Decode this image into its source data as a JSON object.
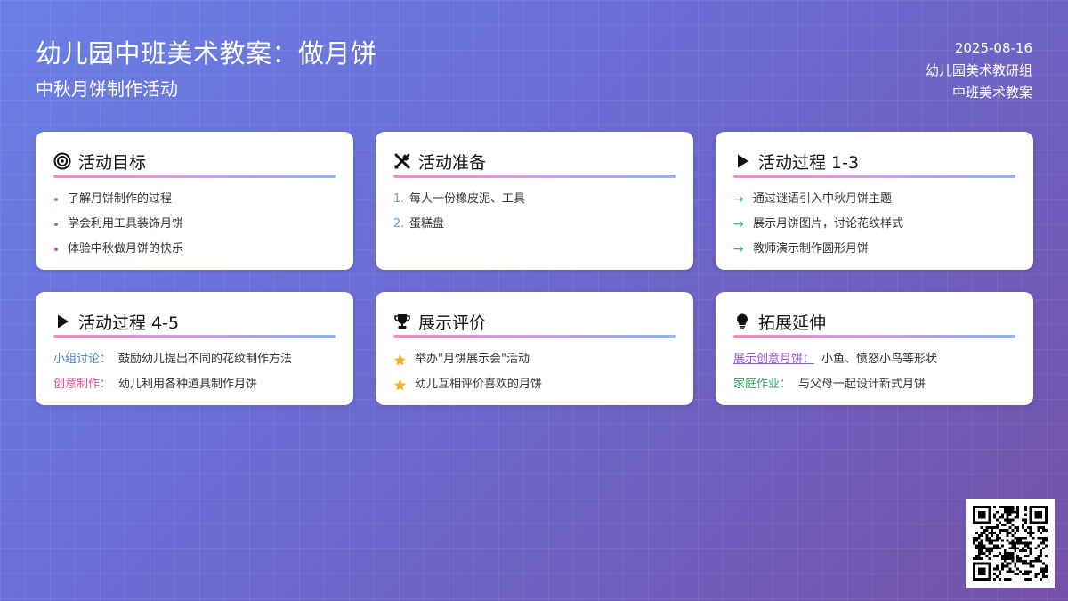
{
  "header": {
    "title": "幼儿园中班美术教案：做月饼",
    "subtitle": "中秋月饼制作活动"
  },
  "meta": {
    "date": "2025-08-16",
    "group": "幼儿园美术教研组",
    "type": "中班美术教案"
  },
  "cards": {
    "goals": {
      "icon": "target-icon",
      "title": "活动目标",
      "items": [
        "了解月饼制作的过程",
        "学会利用工具装饰月饼",
        "体验中秋做月饼的快乐"
      ],
      "dot_colors": [
        "#e0608c",
        "#5a8ad8",
        "#b05cc8"
      ]
    },
    "prep": {
      "icon": "tools-icon",
      "title": "活动准备",
      "numbers": [
        "1.",
        "2."
      ],
      "items": [
        "每人一份橡皮泥、工具",
        "蛋糕盘"
      ]
    },
    "process13": {
      "icon": "play-icon",
      "title": "活动过程 1-3",
      "arrow": "→",
      "items": [
        "通过谜语引入中秋月饼主题",
        "展示月饼图片，讨论花纹样式",
        "教师演示制作圆形月饼"
      ]
    },
    "process45": {
      "icon": "play-icon",
      "title": "活动过程 4-5",
      "rows": [
        {
          "label": "小组讨论：",
          "text": "鼓励幼儿提出不同的花纹制作方法"
        },
        {
          "label": "创意制作：",
          "text": "幼儿利用各种道具制作月饼"
        }
      ]
    },
    "eval": {
      "icon": "trophy-icon",
      "title": "展示评价",
      "items": [
        "举办\"月饼展示会\"活动",
        "幼儿互相评价喜欢的月饼"
      ]
    },
    "extend": {
      "icon": "lightbulb-icon",
      "title": "拓展延伸",
      "rows": [
        {
          "label": "展示创意月饼：",
          "text": "小鱼、愤怒小鸟等形状"
        },
        {
          "label": "家庭作业：",
          "text": "与父母一起设计新式月饼"
        }
      ]
    }
  },
  "colors": {
    "bg_start": "#6a7fe6",
    "bg_end": "#7451a8",
    "accent_bar": [
      "#f08fbf",
      "#c9a0dc",
      "#93b3ee"
    ],
    "star": "#f2b51c",
    "arrow": "#35b86a"
  },
  "qr": {
    "icon": "qr-code-icon"
  }
}
